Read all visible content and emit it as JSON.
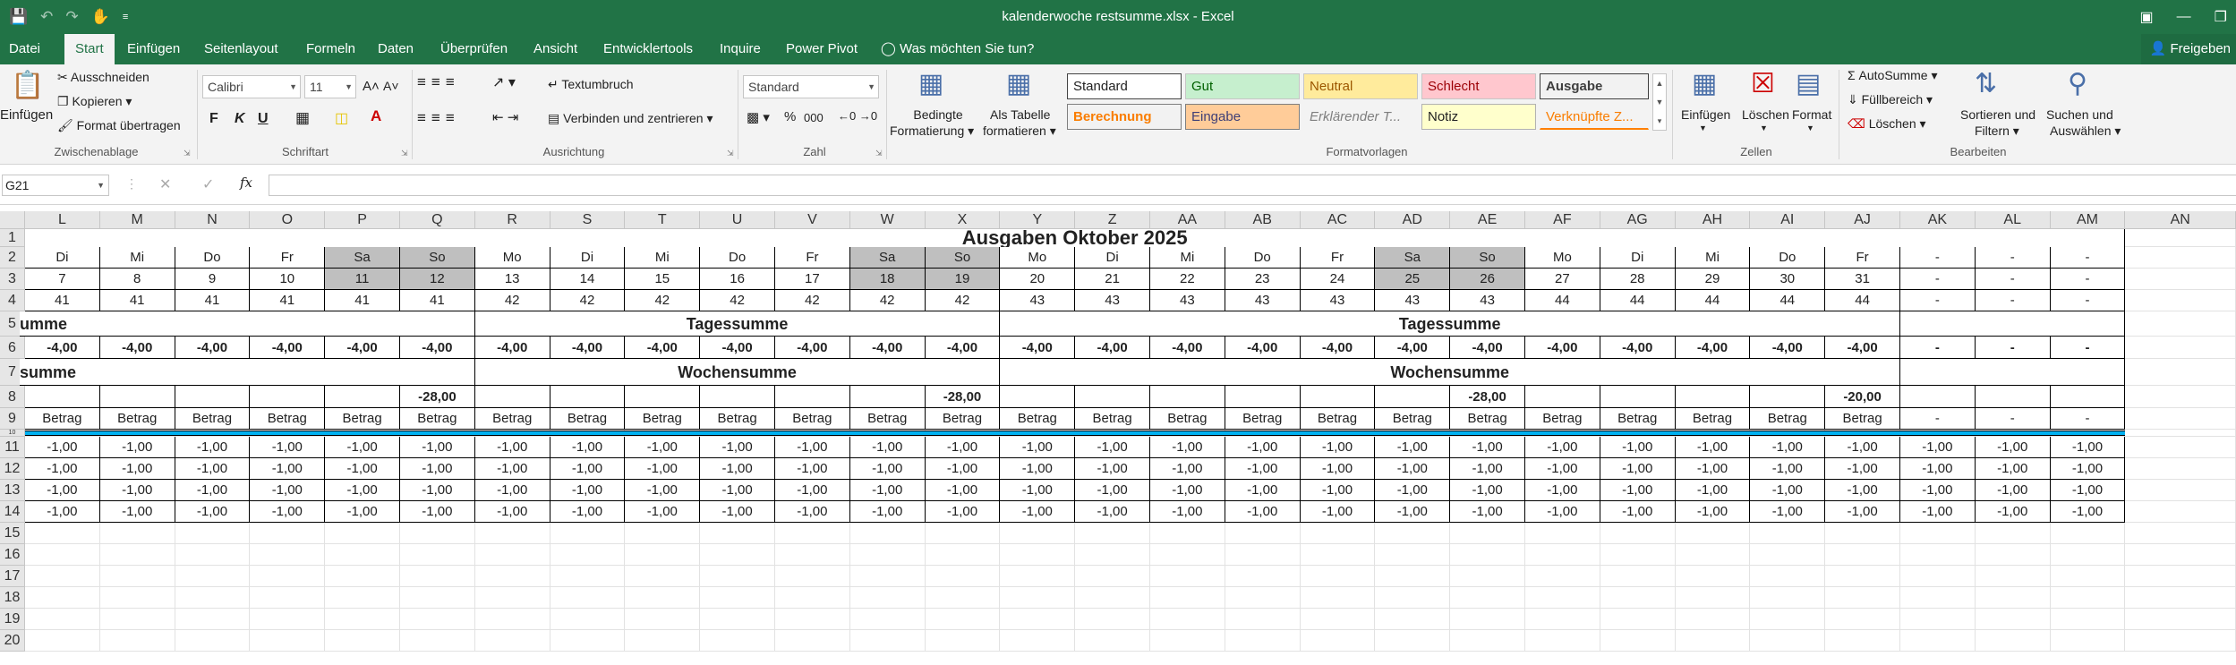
{
  "window": {
    "title": "kalenderwoche restsumme.xlsx - Excel",
    "qat_icons": [
      "save-icon",
      "undo-icon",
      "redo-icon",
      "touch-mode-icon",
      "customize-qat-icon"
    ],
    "control_icons": [
      "ribbon-display-icon",
      "minimize-icon",
      "restore-icon"
    ]
  },
  "tabs": [
    {
      "label": "Datei"
    },
    {
      "label": "Start",
      "active": true
    },
    {
      "label": "Einfügen"
    },
    {
      "label": "Seitenlayout"
    },
    {
      "label": "Formeln"
    },
    {
      "label": "Daten"
    },
    {
      "label": "Überprüfen"
    },
    {
      "label": "Ansicht"
    },
    {
      "label": "Entwicklertools"
    },
    {
      "label": "Inquire"
    },
    {
      "label": "Power Pivot"
    },
    {
      "label": "Was möchten Sie tun?"
    }
  ],
  "share_label": "Freigeben",
  "ribbon": {
    "clipboard": {
      "paste": "Einfügen",
      "cut": "Ausschneiden",
      "copy": "Kopieren",
      "format_painter": "Format übertragen",
      "group": "Zwischenablage"
    },
    "font": {
      "name": "Calibri",
      "size": "11",
      "bold": "F",
      "italic": "K",
      "underline": "U",
      "grow": "A˄",
      "shrink": "A˅",
      "group": "Schriftart"
    },
    "alignment": {
      "wrap": "Textumbruch",
      "merge": "Verbinden und zentrieren",
      "group": "Ausrichtung"
    },
    "number": {
      "format": "Standard",
      "percent": "%",
      "thousands": "000",
      "group": "Zahl"
    },
    "styles": {
      "conditional_line1": "Bedingte",
      "conditional_line2": "Formatierung",
      "as_table_line1": "Als Tabelle",
      "as_table_line2": "formatieren",
      "cells": [
        "Standard",
        "Gut",
        "Neutral",
        "Schlecht",
        "Ausgabe",
        "Berechnung",
        "Eingabe",
        "Erklärender T...",
        "Notiz",
        "Verknüpfte Z..."
      ],
      "group": "Formatvorlagen"
    },
    "cells_group": {
      "insert": "Einfügen",
      "delete": "Löschen",
      "format": "Format",
      "group": "Zellen"
    },
    "editing": {
      "autosum": "AutoSumme",
      "fill": "Füllbereich",
      "clear": "Löschen",
      "sort_line1": "Sortieren und",
      "sort_line2": "Filtern",
      "find_line1": "Suchen und",
      "find_line2": "Auswählen",
      "group": "Bearbeiten"
    }
  },
  "formula_bar": {
    "name_box": "G21",
    "fx": "fx",
    "cancel": "✕",
    "enter": "✓",
    "formula": ""
  },
  "sheet": {
    "columns": [
      "L",
      "M",
      "N",
      "O",
      "P",
      "Q",
      "R",
      "S",
      "T",
      "U",
      "V",
      "W",
      "X",
      "Y",
      "Z",
      "AA",
      "AB",
      "AC",
      "AD",
      "AE",
      "AF",
      "AG",
      "AH",
      "AI",
      "AJ",
      "AK",
      "AL",
      "AM",
      "AN"
    ],
    "rows": [
      "1",
      "2",
      "3",
      "4",
      "5",
      "6",
      "7",
      "8",
      "9",
      "10",
      "11",
      "12",
      "13",
      "14",
      "15",
      "16",
      "17",
      "18",
      "19",
      "20"
    ],
    "title": "Ausgaben Oktober 2025",
    "row5_left": "umme",
    "row5_label_1": "Tagessumme",
    "row5_label_2": "Tagessumme",
    "row7_left": "summe",
    "row7_label_1": "Wochensumme",
    "row7_label_2": "Wochensumme",
    "weekdays": [
      "Di",
      "Mi",
      "Do",
      "Fr",
      "Sa",
      "So",
      "Mo",
      "Di",
      "Mi",
      "Do",
      "Fr",
      "Sa",
      "So",
      "Mo",
      "Di",
      "Mi",
      "Do",
      "Fr",
      "Sa",
      "So",
      "Mo",
      "Di",
      "Mi",
      "Do",
      "Fr",
      "-",
      "-",
      "-"
    ],
    "days": [
      "7",
      "8",
      "9",
      "10",
      "11",
      "12",
      "13",
      "14",
      "15",
      "16",
      "17",
      "18",
      "19",
      "20",
      "21",
      "22",
      "23",
      "24",
      "25",
      "26",
      "27",
      "28",
      "29",
      "30",
      "31",
      "-",
      "-",
      "-"
    ],
    "weeks": [
      "41",
      "41",
      "41",
      "41",
      "41",
      "41",
      "42",
      "42",
      "42",
      "42",
      "42",
      "42",
      "42",
      "43",
      "43",
      "43",
      "43",
      "43",
      "43",
      "43",
      "44",
      "44",
      "44",
      "44",
      "44",
      "-",
      "-",
      "-"
    ],
    "day_totals": [
      "-4,00",
      "-4,00",
      "-4,00",
      "-4,00",
      "-4,00",
      "-4,00",
      "-4,00",
      "-4,00",
      "-4,00",
      "-4,00",
      "-4,00",
      "-4,00",
      "-4,00",
      "-4,00",
      "-4,00",
      "-4,00",
      "-4,00",
      "-4,00",
      "-4,00",
      "-4,00",
      "-4,00",
      "-4,00",
      "-4,00",
      "-4,00",
      "-4,00",
      "-",
      "-",
      "-"
    ],
    "week_totals": [
      "",
      "",
      "",
      "",
      "",
      "-28,00",
      "",
      "",
      "",
      "",
      "",
      "",
      "-28,00",
      "",
      "",
      "",
      "",
      "",
      "",
      "-28,00",
      "",
      "",
      "",
      "",
      "-20,00",
      "",
      "",
      ""
    ],
    "amount_header": [
      "Betrag",
      "Betrag",
      "Betrag",
      "Betrag",
      "Betrag",
      "Betrag",
      "Betrag",
      "Betrag",
      "Betrag",
      "Betrag",
      "Betrag",
      "Betrag",
      "Betrag",
      "Betrag",
      "Betrag",
      "Betrag",
      "Betrag",
      "Betrag",
      "Betrag",
      "Betrag",
      "Betrag",
      "Betrag",
      "Betrag",
      "Betrag",
      "Betrag",
      "-",
      "-",
      "-"
    ],
    "entry_rows": [
      [
        "-1,00",
        "-1,00",
        "-1,00",
        "-1,00",
        "-1,00",
        "-1,00",
        "-1,00",
        "-1,00",
        "-1,00",
        "-1,00",
        "-1,00",
        "-1,00",
        "-1,00",
        "-1,00",
        "-1,00",
        "-1,00",
        "-1,00",
        "-1,00",
        "-1,00",
        "-1,00",
        "-1,00",
        "-1,00",
        "-1,00",
        "-1,00",
        "-1,00",
        "-1,00",
        "-1,00",
        "-1,00"
      ],
      [
        "-1,00",
        "-1,00",
        "-1,00",
        "-1,00",
        "-1,00",
        "-1,00",
        "-1,00",
        "-1,00",
        "-1,00",
        "-1,00",
        "-1,00",
        "-1,00",
        "-1,00",
        "-1,00",
        "-1,00",
        "-1,00",
        "-1,00",
        "-1,00",
        "-1,00",
        "-1,00",
        "-1,00",
        "-1,00",
        "-1,00",
        "-1,00",
        "-1,00",
        "-1,00",
        "-1,00",
        "-1,00"
      ],
      [
        "-1,00",
        "-1,00",
        "-1,00",
        "-1,00",
        "-1,00",
        "-1,00",
        "-1,00",
        "-1,00",
        "-1,00",
        "-1,00",
        "-1,00",
        "-1,00",
        "-1,00",
        "-1,00",
        "-1,00",
        "-1,00",
        "-1,00",
        "-1,00",
        "-1,00",
        "-1,00",
        "-1,00",
        "-1,00",
        "-1,00",
        "-1,00",
        "-1,00",
        "-1,00",
        "-1,00",
        "-1,00"
      ],
      [
        "-1,00",
        "-1,00",
        "-1,00",
        "-1,00",
        "-1,00",
        "-1,00",
        "-1,00",
        "-1,00",
        "-1,00",
        "-1,00",
        "-1,00",
        "-1,00",
        "-1,00",
        "-1,00",
        "-1,00",
        "-1,00",
        "-1,00",
        "-1,00",
        "-1,00",
        "-1,00",
        "-1,00",
        "-1,00",
        "-1,00",
        "-1,00",
        "-1,00",
        "-1,00",
        "-1,00",
        "-1,00"
      ]
    ],
    "weekend_fill": "#bfbfbf",
    "separator_color": "#00b0f0"
  },
  "colors": {
    "brand": "#217346"
  }
}
